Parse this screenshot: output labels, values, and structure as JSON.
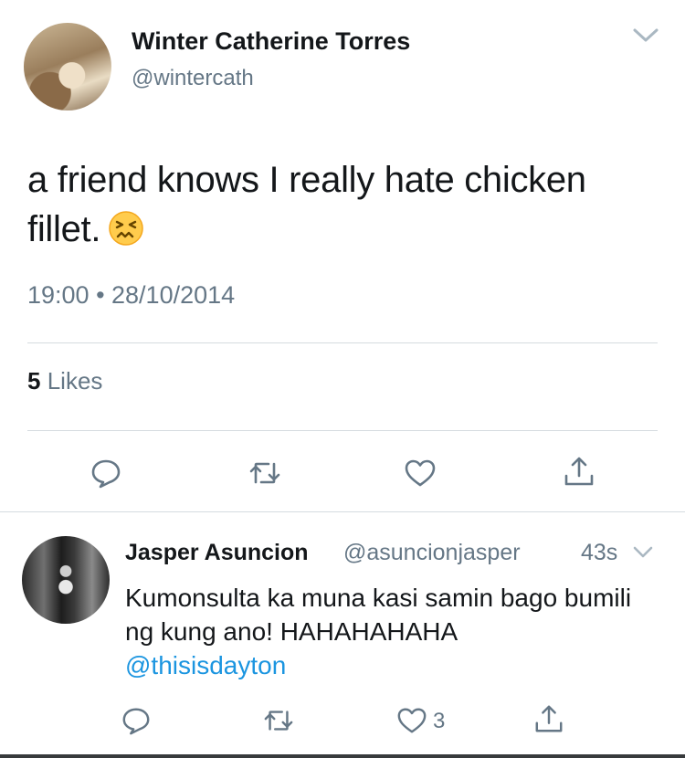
{
  "tweet": {
    "display_name": "Winter Catherine Torres",
    "handle": "@wintercath",
    "text": "a friend knows I really hate chicken fillet.",
    "emoji": "confounded-face",
    "timestamp": "19:00 • 28/10/2014",
    "likes_count": "5",
    "likes_label": "Likes",
    "actions": [
      "reply-icon",
      "retweet-icon",
      "like-icon",
      "share-icon"
    ]
  },
  "reply": {
    "display_name": "Jasper Asuncion",
    "handle": "@asuncionjasper",
    "time": "43s",
    "text": "Kumonsulta ka muna kasi samin bago bumili ng kung ano! HAHAHAHAHA",
    "mention": "@thisisdayton",
    "like_count": "3",
    "actions": [
      "reply-icon",
      "retweet-icon",
      "like-icon",
      "share-icon"
    ]
  },
  "colors": {
    "text_primary": "#14171a",
    "text_secondary": "#657786",
    "link": "#1b95e0",
    "divider": "#d5dbe0"
  }
}
